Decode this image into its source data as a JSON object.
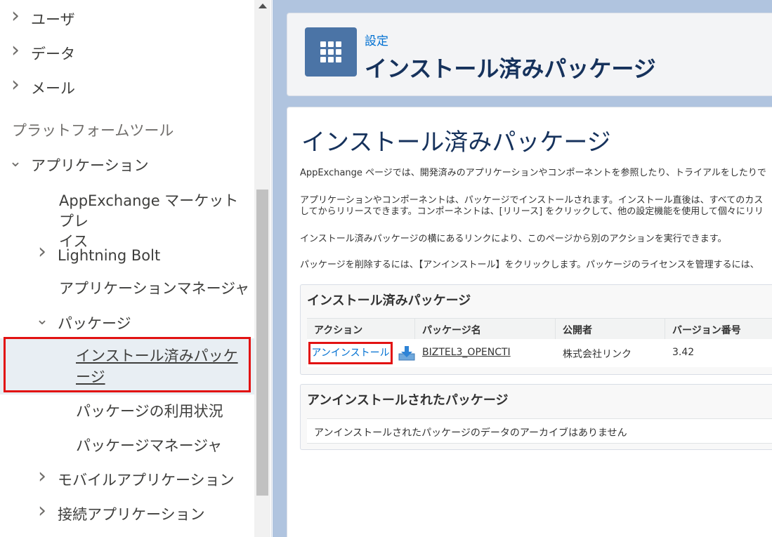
{
  "sidebar": {
    "items": [
      {
        "label": "ユーザ",
        "chevron": "right"
      },
      {
        "label": "データ",
        "chevron": "right"
      },
      {
        "label": "メール",
        "chevron": "right"
      }
    ],
    "section_header": "プラットフォームツール",
    "applications": {
      "label": "アプリケーション",
      "chevron": "down"
    },
    "appexchange": {
      "line1": "AppExchange マーケットプレ",
      "line2": "イス"
    },
    "lightning_bolt": {
      "label": "Lightning Bolt",
      "chevron": "right"
    },
    "app_manager": "アプリケーションマネージャ",
    "packages": {
      "label": "パッケージ",
      "chevron": "down"
    },
    "installed_packages": "インストール済みパッケージ",
    "package_usage": "パッケージの利用状況",
    "package_manager": "パッケージマネージャ",
    "mobile_apps": {
      "label": "モバイルアプリケーション",
      "chevron": "right"
    },
    "connected_apps": {
      "label": "接続アプリケーション",
      "chevron": "right"
    }
  },
  "header": {
    "breadcrumb": "設定",
    "title": "インストール済みパッケージ",
    "icon": "grid-icon"
  },
  "main": {
    "page_title": "インストール済みパッケージ",
    "paragraphs": [
      "AppExchange ページでは、開発済みのアプリケーションやコンポーネントを参照したり、トライアルをしたりで",
      "アプリケーションやコンポーネントは、パッケージでインストールされます。インストール直後は、すべてのカス",
      "してからリリースできます。コンポーネントは、[リリース] をクリックして、他の設定機能を使用して個々にリリ",
      "インストール済みパッケージの横にあるリンクにより、このページから別のアクションを実行できます。",
      "パッケージを削除するには、【アンインストール】をクリックします。パッケージのライセンスを管理するには、"
    ],
    "installed_panel": {
      "title": "インストール済みパッケージ",
      "columns": [
        "アクション",
        "パッケージ名",
        "公開者",
        "バージョン番号"
      ],
      "rows": [
        {
          "action": "アンインストール",
          "package": "BIZTEL3_OPENCTI",
          "publisher": "株式会社リンク",
          "version": "3.42"
        }
      ]
    },
    "uninstalled_panel": {
      "title": "アンインストールされたパッケージ",
      "empty_message": "アンインストールされたパッケージのデータのアーカイブはありません"
    }
  },
  "colors": {
    "highlight": "#e21212",
    "link": "#0070d2",
    "icon_bg": "#4b74a6",
    "main_bg": "#b0c4df"
  }
}
